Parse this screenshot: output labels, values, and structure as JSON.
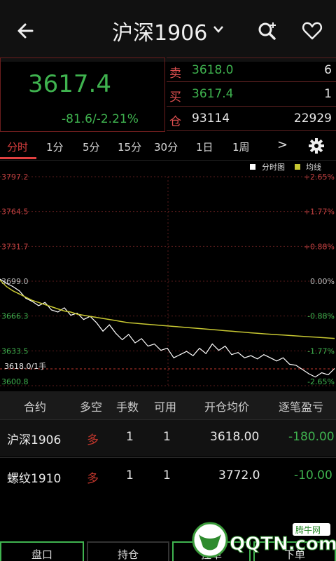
{
  "header": {
    "title": "沪深1906",
    "icons": {
      "back": "back-arrow-icon",
      "dropdown": "chevron-down-icon",
      "search": "search-plus-icon",
      "favorite": "heart-icon"
    }
  },
  "quote": {
    "last_price": "3617.4",
    "change": "-81.6/-2.21%",
    "sell": {
      "label": "卖",
      "price": "3618.0",
      "volume": "6"
    },
    "buy": {
      "label": "买",
      "price": "3617.4",
      "volume": "1"
    },
    "position": {
      "label": "仓",
      "value": "93114",
      "change": "22929"
    },
    "colors": {
      "down": "#3fb34f",
      "up": "#e05050"
    }
  },
  "period_tabs": [
    "分时",
    "1分",
    "5分",
    "15分",
    "30分",
    "1日",
    "1周"
  ],
  "more_label": ">",
  "chart_data": {
    "type": "line",
    "legend": [
      "分时图",
      "均线"
    ],
    "y_left_ticks": [
      "3797.2",
      "3764.5",
      "3731.7",
      "3699.0",
      "3666.3",
      "3633.5",
      "3600.8"
    ],
    "y_right_ticks": [
      "+2.65%",
      "+1.77%",
      "+0.88%",
      "0.00%",
      "-0.88%",
      "-1.77%",
      "-2.65%"
    ],
    "ylim": [
      3600.8,
      3797.2
    ],
    "price_label": "3618.0/1手",
    "series": [
      {
        "name": "分时图",
        "color": "#ffffff",
        "values": [
          3701,
          3697,
          3694,
          3690,
          3683,
          3680,
          3676,
          3679,
          3672,
          3670,
          3674,
          3667,
          3669,
          3663,
          3666,
          3660,
          3652,
          3658,
          3650,
          3644,
          3649,
          3641,
          3645,
          3638,
          3640,
          3634,
          3636,
          3627,
          3630,
          3633,
          3629,
          3636,
          3631,
          3640,
          3634,
          3638,
          3630,
          3632,
          3627,
          3629,
          3626,
          3630,
          3627,
          3624,
          3627,
          3621,
          3620,
          3616,
          3612,
          3609,
          3613,
          3611,
          3617
        ]
      },
      {
        "name": "均线",
        "color": "#c8c832",
        "values": [
          3700,
          3694,
          3690,
          3687,
          3684,
          3681,
          3679,
          3677,
          3675,
          3673,
          3671,
          3670,
          3668,
          3667,
          3666,
          3665,
          3664,
          3663,
          3662,
          3661,
          3660,
          3659.5,
          3659,
          3658.5,
          3658,
          3657.5,
          3657,
          3656.5,
          3656,
          3655.5,
          3655,
          3654.5,
          3654,
          3653.5,
          3653,
          3652.5,
          3652,
          3651.5,
          3651,
          3650.5,
          3650,
          3649.6,
          3649.2,
          3648.8,
          3648.4,
          3648,
          3647.6,
          3647.2,
          3646.8,
          3646.4,
          3646,
          3645.6,
          3645.2
        ]
      }
    ]
  },
  "table": {
    "headers": [
      "合约",
      "多空",
      "手数",
      "可用",
      "开仓均价",
      "逐笔盈亏"
    ],
    "rows": [
      {
        "contract": "沪深1906",
        "direction": "多",
        "lots": "1",
        "available": "1",
        "avg_price": "3618.00",
        "pnl": "-180.00"
      },
      {
        "contract": "螺纹1910",
        "direction": "多",
        "lots": "1",
        "available": "1",
        "avg_price": "3772.0",
        "pnl": "-10.00"
      }
    ]
  },
  "bottom_nav": [
    "盘口",
    "持仓",
    "挂单",
    "下单"
  ],
  "watermark": {
    "text": "QQTN.com",
    "subtext": "腾牛网"
  }
}
